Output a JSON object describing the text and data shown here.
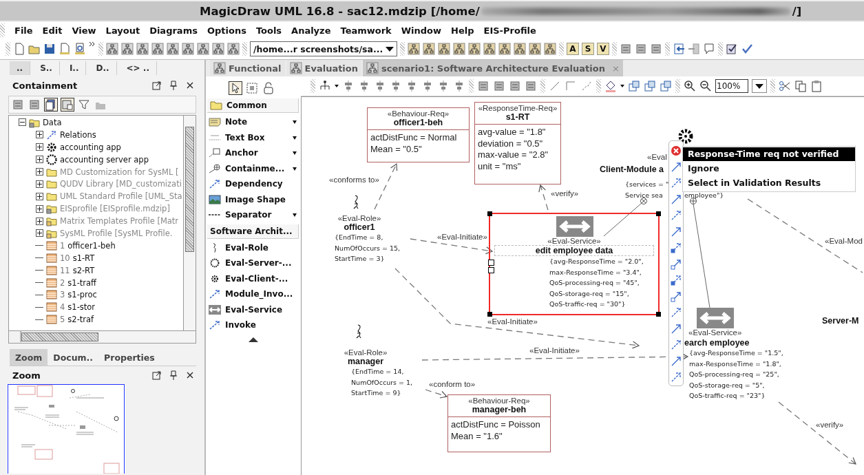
{
  "window": {
    "title": "MagicDraw UML 16.8 - sac12.mdzip [/home/",
    "title_end": "/]"
  },
  "menu": [
    "File",
    "Edit",
    "View",
    "Layout",
    "Diagrams",
    "Options",
    "Tools",
    "Analyze",
    "Teamwork",
    "Window",
    "Help",
    "EIS-Profile"
  ],
  "toolbar": {
    "path_dropdown": "/home...r screenshots/sa...",
    "letter_buttons": [
      "A",
      "S",
      "V"
    ]
  },
  "browser_tabs": [
    {
      "label": "..",
      "selected": true
    },
    {
      "label": "S..",
      "selected": false
    },
    {
      "label": "I..",
      "selected": false
    },
    {
      "label": "D..",
      "selected": false
    },
    {
      "label": "<> ..",
      "selected": false
    }
  ],
  "containment": {
    "title": "Containment",
    "tree": [
      {
        "label": "Data",
        "kind": "data",
        "expanded": true,
        "greyed": false,
        "children": [
          {
            "label": "Relations",
            "kind": "relations",
            "expanded": false,
            "greyed": false
          },
          {
            "label": "accounting app",
            "kind": "client",
            "expanded": false,
            "greyed": false
          },
          {
            "label": "accounting server app",
            "kind": "server",
            "expanded": false,
            "greyed": false
          },
          {
            "label": "MD Customization for SysML [",
            "kind": "library",
            "expanded": false,
            "greyed": true
          },
          {
            "label": "QUDV Library [MD_customizati",
            "kind": "library",
            "expanded": false,
            "greyed": true
          },
          {
            "label": "UML Standard Profile [UML_Sta",
            "kind": "library",
            "expanded": false,
            "greyed": true
          },
          {
            "label": "EISprofile [EISprofile.mdzip]",
            "kind": "data",
            "expanded": false,
            "greyed": true
          },
          {
            "label": "Matrix Templates Profile [Matr",
            "kind": "profile",
            "expanded": false,
            "greyed": true
          },
          {
            "label": "SysML Profile [SysML Profile.",
            "kind": "profile",
            "expanded": false,
            "greyed": true
          },
          {
            "number": "1",
            "label": "officer1-beh",
            "kind": "requirement",
            "greyed": false
          },
          {
            "number": "10",
            "label": "s1-RT",
            "kind": "requirement",
            "greyed": false
          },
          {
            "number": "11",
            "label": "s2-RT",
            "kind": "requirement",
            "greyed": false
          },
          {
            "number": "2",
            "label": "s1-traff",
            "kind": "requirement",
            "greyed": false
          },
          {
            "number": "3",
            "label": "s1-proc",
            "kind": "requirement",
            "greyed": false
          },
          {
            "number": "4",
            "label": "s1-stor",
            "kind": "requirement",
            "greyed": false
          },
          {
            "number": "5",
            "label": "s2-traf",
            "kind": "requirement",
            "greyed": false
          }
        ]
      }
    ]
  },
  "bottom_tabs": [
    {
      "label": "Zoom",
      "selected": true
    },
    {
      "label": "Docum..",
      "selected": false
    },
    {
      "label": "Properties",
      "selected": false
    }
  ],
  "zoom_panel": {
    "title": "Zoom"
  },
  "diagram_tabs": [
    {
      "label": "Functional",
      "selected": false
    },
    {
      "label": "Evaluation",
      "selected": false
    },
    {
      "label": "scenario1: Software Architecture Evaluation",
      "selected": true,
      "close_mark": "×"
    }
  ],
  "palette": {
    "groups": [
      {
        "title": "Common",
        "kind": "folder",
        "items": [
          {
            "label": "Note",
            "kind": "note",
            "has_menu": true
          },
          {
            "label": "Text Box",
            "kind": "textbox",
            "has_menu": true
          },
          {
            "label": "Anchor",
            "kind": "anchor",
            "has_menu": true
          },
          {
            "label": "Containme...",
            "kind": "containment",
            "has_menu": true
          },
          {
            "label": "Dependency",
            "kind": "arrow",
            "has_menu": false
          },
          {
            "label": "Image Shape",
            "kind": "image",
            "has_menu": false
          },
          {
            "label": "Separator",
            "kind": "separator",
            "has_menu": true
          }
        ]
      },
      {
        "title": "Software Archit...",
        "kind": "plain",
        "items": [
          {
            "label": "Eval-Role",
            "kind": "role",
            "has_menu": false
          },
          {
            "label": "Eval-Server-...",
            "kind": "server",
            "has_menu": false
          },
          {
            "label": "Eval-Client-...",
            "kind": "client",
            "has_menu": false
          },
          {
            "label": "Module_Invo...",
            "kind": "arrow",
            "has_menu": false
          },
          {
            "label": "Eval-Service",
            "kind": "service",
            "has_menu": false
          },
          {
            "label": "Invoke",
            "kind": "arrow",
            "has_menu": false
          }
        ]
      }
    ]
  },
  "diagram_toolbar": {
    "zoom": "100%"
  },
  "diagram": {
    "requirements": [
      {
        "stereotype": "«Behaviour-Req»",
        "name": "officer1-beh",
        "attributes": [
          "actDistFunc = Normal",
          "Mean = \"0.5\""
        ]
      },
      {
        "stereotype": "«ResponseTime-Req»",
        "name": "s1-RT",
        "attributes": [
          "avg-value = \"1.8\"",
          "deviation = \"0.5\"",
          "max-value = \"2.8\"",
          "unit = \"ms\""
        ]
      },
      {
        "stereotype": "«Behaviour-Req»",
        "name": "manager-beh",
        "attributes": [
          "actDistFunc = Poisson",
          "Mean = \"1.6\""
        ]
      }
    ],
    "roles": [
      {
        "stereotype": "«Eval-Role»",
        "name": "officer1",
        "constraints": [
          "{EndTime = 8,",
          "NumOfOccurs = 15,",
          "StartTime = 3}"
        ]
      },
      {
        "stereotype": "«Eval-Role»",
        "name": "manager",
        "constraints": [
          "{EndTime = 14,",
          "NumOfOccurs = 1,",
          "StartTime = 9}"
        ]
      }
    ],
    "services": [
      {
        "stereotype": "«Eval-Service»",
        "name": "edit employee data",
        "selected": true,
        "constraints": [
          "{avg-ResponseTime = \"2.0\",",
          "max-ResponseTime = \"3.4\",",
          "QoS-processing-req = \"45\",",
          "QoS-storage-req = \"15\",",
          "QoS-traffic-req = \"30\"}"
        ]
      },
      {
        "stereotype": "«Eval-Service»",
        "name": "earch employee",
        "selected": false,
        "constraints": [
          "{avg-ResponseTime = \"1.5\",",
          "max-ResponseTime = \"1.8\",",
          "QoS-processing-req = \"25\",",
          "QoS-storage-req = \"5\",",
          "QoS-traffic-req = \"23\"}"
        ]
      }
    ],
    "client_module": {
      "stereotype": "«Eval",
      "name": "Client-Module a",
      "constraints": [
        "{services = \"",
        "Service sea"
      ],
      "constraint_tail": "employee\"}"
    },
    "server_module": {
      "stereotype": "«Eval-Mod",
      "name": "Server-M"
    },
    "connectors": [
      {
        "label": "«conforms to»"
      },
      {
        "label": "«Eval-Initiate»"
      },
      {
        "label": "«verify»"
      },
      {
        "label": "«Eval-Initiate»"
      },
      {
        "label": "«Eval-Initiate»"
      },
      {
        "label": "«conform to»"
      },
      {
        "label": "«verify»"
      }
    ],
    "validation_popup": [
      {
        "label": "Response-Time req not verified",
        "selected": true
      },
      {
        "label": "Ignore",
        "selected": false
      },
      {
        "label": "Select in Validation Results",
        "selected": false
      }
    ]
  }
}
